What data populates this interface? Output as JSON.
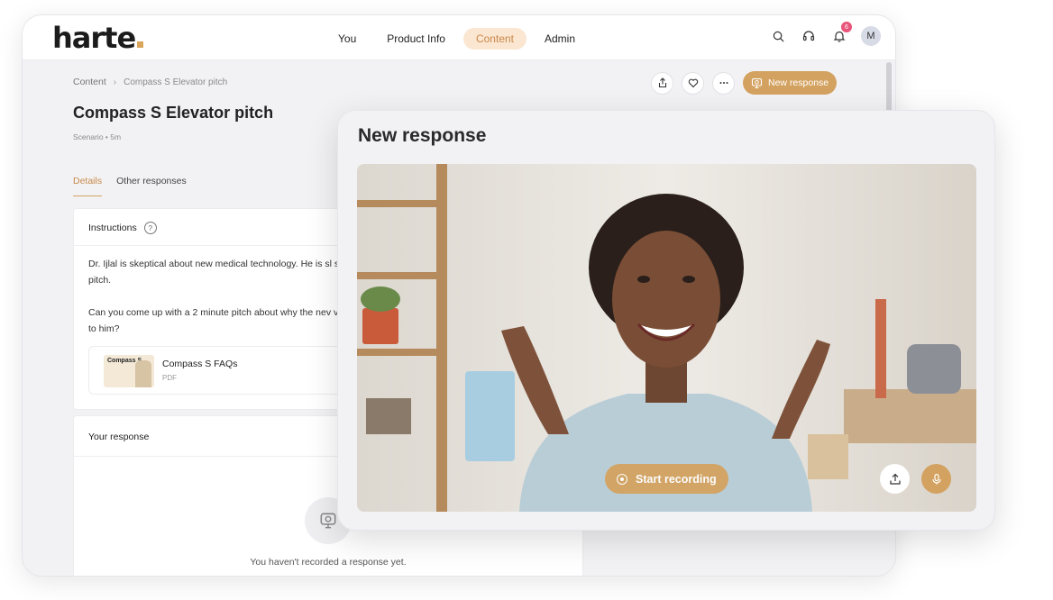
{
  "app": {
    "logo": "harte"
  },
  "nav": {
    "items": [
      {
        "label": "You"
      },
      {
        "label": "Product Info"
      },
      {
        "label": "Content"
      },
      {
        "label": "Admin"
      }
    ]
  },
  "notifications": {
    "count": "6"
  },
  "user": {
    "initial": "M"
  },
  "breadcrumb": {
    "root": "Content",
    "current": "Compass S Elevator pitch"
  },
  "page": {
    "title": "Compass S Elevator pitch",
    "meta": "Scenario • 5m"
  },
  "actions": {
    "new_response_label": "New response"
  },
  "tabs": [
    {
      "label": "Details"
    },
    {
      "label": "Other responses"
    }
  ],
  "instructions": {
    "heading": "Instructions",
    "para1": "Dr. Ijlal is skeptical about new medical technology. He is sl sales pitch.",
    "para2": "Can you come up with a 2 minute pitch about why the nev value to him?",
    "attachment": {
      "thumb_label": "Compass S",
      "name": "Compass S FAQs",
      "type": "PDF"
    }
  },
  "your_response": {
    "heading": "Your response",
    "empty_text": "You haven't recorded a response yet."
  },
  "modal": {
    "title": "New response",
    "start_label": "Start recording"
  },
  "colors": {
    "accent": "#d4a260",
    "accent_soft": "#fbe6d2",
    "badge": "#e8557a"
  }
}
